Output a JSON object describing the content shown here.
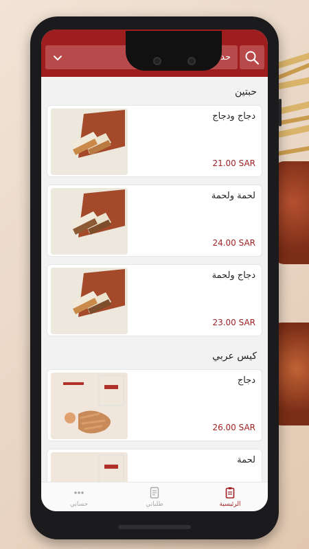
{
  "header": {
    "order_type_placeholder": "حدد نوع الطلب",
    "search_icon": "search-icon",
    "dropdown_icon": "chevron-down-icon"
  },
  "sections": [
    {
      "title": "حبتين",
      "items": [
        {
          "name": "دجاج ودجاج",
          "price": "21.00 SAR"
        },
        {
          "name": "لحمة ولحمة",
          "price": "24.00 SAR"
        },
        {
          "name": "دجاج ولحمة",
          "price": "23.00 SAR"
        }
      ]
    },
    {
      "title": "كيس عربي",
      "items": [
        {
          "name": "دجاج",
          "price": "26.00 SAR"
        },
        {
          "name": "لحمة",
          "price": ""
        }
      ]
    }
  ],
  "nav": {
    "account": "حسابي",
    "orders": "طلباتي",
    "home": "الرئيسية"
  },
  "colors": {
    "brand": "#9e1d1f",
    "header_field": "#b84a4c",
    "inactive": "#a8a8a8"
  }
}
